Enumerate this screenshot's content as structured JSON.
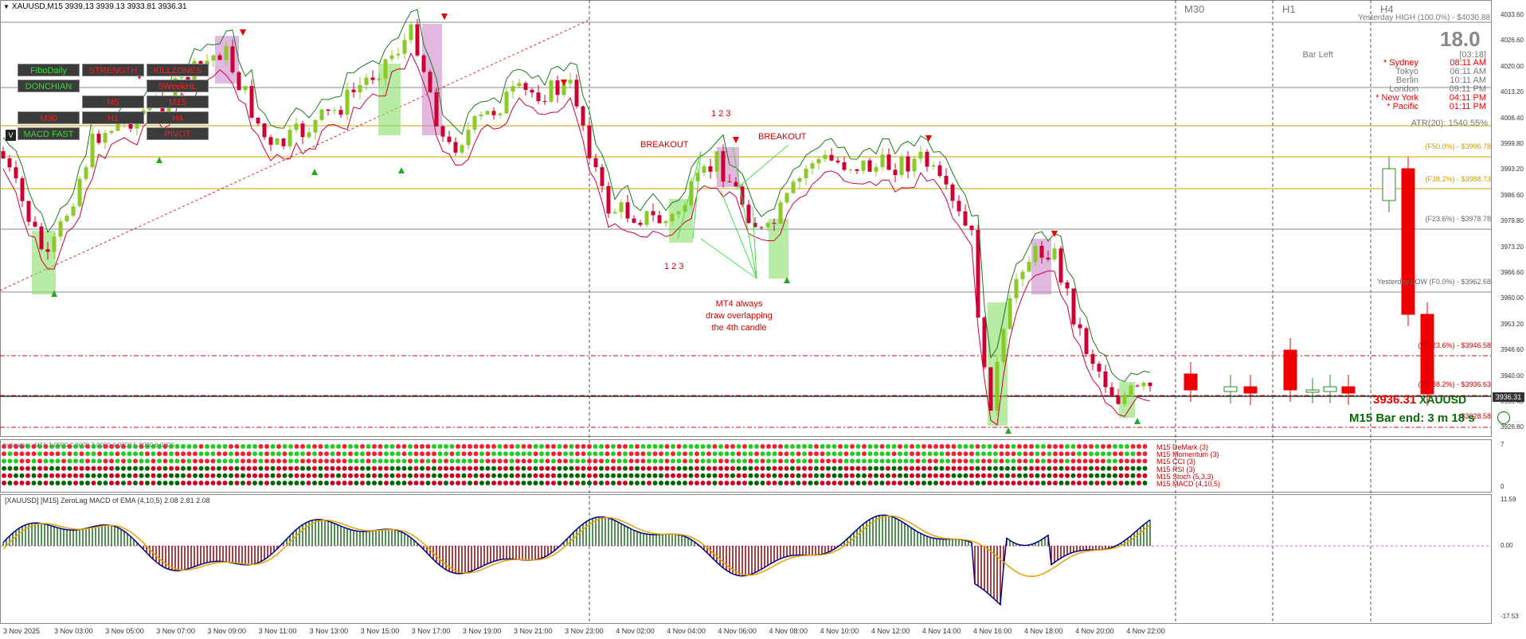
{
  "title_bar": {
    "symbol_line": "XAUUSD,M15  3939.13 3939.13 3933.81 3936.31"
  },
  "timeframe_headers": [
    "M30",
    "H1",
    "H4"
  ],
  "buttons": [
    {
      "label": "FiboDaily",
      "color": "green"
    },
    {
      "label": "STRENGTH",
      "color": "red"
    },
    {
      "label": "KILLZONES",
      "color": "red"
    },
    {
      "label": "DONCHIAN",
      "color": "green"
    },
    {
      "label": "5WeekHL",
      "color": "red"
    },
    {
      "label": "M5",
      "color": "red"
    },
    {
      "label": "M15",
      "color": "red"
    },
    {
      "label": "M30",
      "color": "red"
    },
    {
      "label": "H1",
      "color": "red"
    },
    {
      "label": "H4",
      "color": "red"
    },
    {
      "label": "MACD FAST",
      "color": "green"
    },
    {
      "label": "PIVOT",
      "color": "red"
    }
  ],
  "side_toggle": "V",
  "info_panel": {
    "yesterday_high": "Yesterday HIGH (100.0%) - $4030.88",
    "big_value": "18.0",
    "bar_left_label": "Bar Left",
    "bar_left_value": "[03:18]",
    "sessions": [
      {
        "name": "* Sydney",
        "time": "08:11 AM",
        "active": true
      },
      {
        "name": "Tokyo",
        "time": "06:11 AM",
        "active": false
      },
      {
        "name": "Berlin",
        "time": "10:11 AM",
        "active": false
      },
      {
        "name": "London",
        "time": "09:11 PM",
        "active": false
      },
      {
        "name": "* New York",
        "time": "04:11 PM",
        "active": true
      },
      {
        "name": "* Pacific",
        "time": "01:11 PM",
        "active": true
      }
    ],
    "atr_line": "ATR(20): 1540.55%"
  },
  "fibo_levels": [
    {
      "label": "(F50.0%) - $3996.78",
      "color": "#c8a000"
    },
    {
      "label": "(F38.2%) - $3988.73",
      "color": "#c8a000"
    },
    {
      "label": "(F23.6%) - $3978.78",
      "color": "#666666"
    },
    {
      "label": "Yesterday LOW (F0.0%) - $3962.68",
      "color": "#666666"
    },
    {
      "label": "(FE-23.6%) - $3946.58",
      "color": "#cc0000"
    },
    {
      "label": "(FE-38.2%) - $3936.63",
      "color": "#cc0000"
    },
    {
      "label": "$3928.58",
      "color": "#cc0000"
    }
  ],
  "price_axis": [
    "4033.60",
    "4026.60",
    "4020.00",
    "4013.20",
    "4006.40",
    "3999.80",
    "3993.20",
    "3986.60",
    "3979.80",
    "3973.20",
    "3966.60",
    "3960.00",
    "3953.20",
    "3946.60",
    "3940.00",
    "3933.40",
    "3926.80"
  ],
  "current_price": "3936.31",
  "price_overlay": {
    "price": "3936.31",
    "symbol": "XAUUSD",
    "bar_end": "M15 Bar end: 3 m 18 s"
  },
  "annotations": {
    "breakout_left": "BREAKOUT",
    "breakout_right": "BREAKOUT",
    "count_top": "1  2  3",
    "count_bottom": "1  2  3",
    "note_lines": [
      "MT4 always",
      "draw  overlapping",
      "the  4th  candle"
    ]
  },
  "dots_panel": {
    "header": "Indicators:  M15 1.0000 2.0000 3.0000 4.0000 5.0000 6.0000",
    "labels": [
      "M15 DeMark (3)",
      "M15 Momentum (3)",
      "M15 CCI (3)",
      "M15 RSI (3)",
      "M15 Stoch (5,3,3)",
      "M15 MACD (4,10,5)"
    ],
    "axis": [
      "7",
      "0"
    ]
  },
  "macd_panel": {
    "title": "[XAUUSD] [M15] ZeroLag MACD of EMA (4,10,5) 2.08 2.81 2.08",
    "axis": [
      "11.59",
      "0.00",
      "-17.53"
    ]
  },
  "time_axis": [
    "3 Nov 2025",
    "3 Nov 03:00",
    "3 Nov 05:00",
    "3 Nov 07:00",
    "3 Nov 09:00",
    "3 Nov 11:00",
    "3 Nov 13:00",
    "3 Nov 15:00",
    "3 Nov 17:00",
    "3 Nov 19:00",
    "3 Nov 21:00",
    "3 Nov 23:00",
    "4 Nov 02:00",
    "4 Nov 04:00",
    "4 Nov 06:00",
    "4 Nov 08:00",
    "4 Nov 10:00",
    "4 Nov 12:00",
    "4 Nov 14:00",
    "4 Nov 16:00",
    "4 Nov 18:00",
    "4 Nov 20:00",
    "4 Nov 22:00"
  ],
  "colors": {
    "up": "#8ac926",
    "down": "#cc0033",
    "channel_upper": "#1a7a1a",
    "channel_lower": "#cc0033",
    "highlight_pink": "#cc88cc",
    "highlight_green": "#88dd66"
  }
}
